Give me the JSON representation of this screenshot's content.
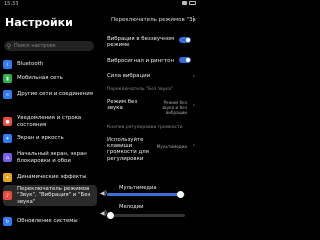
{
  "status": {
    "time": "15:33"
  },
  "left": {
    "title": "Настройки",
    "search_placeholder": "Поиск настроек",
    "items": [
      {
        "label": "Bluetooth",
        "color": "#2f7bf5",
        "icon": "bluetooth-icon"
      },
      {
        "label": "Мобильная сеть",
        "color": "#2bb24c",
        "icon": "signal-icon"
      },
      {
        "label": "Другие сети и соединения",
        "color": "#2f7bf5",
        "icon": "link-icon"
      },
      {
        "label": "Уведомления и строка состояния",
        "color": "#e84b3c",
        "icon": "bell-icon"
      },
      {
        "label": "Экран и яркость",
        "color": "#2f7bf5",
        "icon": "sun-icon"
      },
      {
        "label": "Начальный экран, экран блокировки и обои",
        "color": "#7a5cf0",
        "icon": "home-icon"
      },
      {
        "label": "Динамические эффекты",
        "color": "#e8a21c",
        "icon": "sparkle-icon"
      },
      {
        "label": "Переключатель режимов \"Звук\", \"Вибрация\" и \"Без звука\"",
        "color": "#e84b3c",
        "icon": "volume-icon"
      },
      {
        "label": "Обновление системы",
        "color": "#2f7bf5",
        "icon": "update-icon"
      }
    ]
  },
  "right": {
    "title": "Переключатель режимов \"Зв",
    "vibrate_silent": "Вибрация в беззвучном режиме",
    "vibrate_ring": "Вибросигнал и рингтон",
    "vibration_strength": "Сила вибрации",
    "section_silent": "Переключатель \"Без звука\"",
    "silent_mode_label": "Режим без звука",
    "silent_mode_value": "Режим без звука и без вибрации",
    "section_volume": "Кнопки регулировки громкости",
    "volume_keys_label": "Используйте клавиши громкости для регулировки",
    "volume_keys_value": "Мультимедиа",
    "media_label": "Мультимедиа",
    "ringtone_label": "Мелодии",
    "media_level": 0.93,
    "ringtone_level": 0.0
  }
}
